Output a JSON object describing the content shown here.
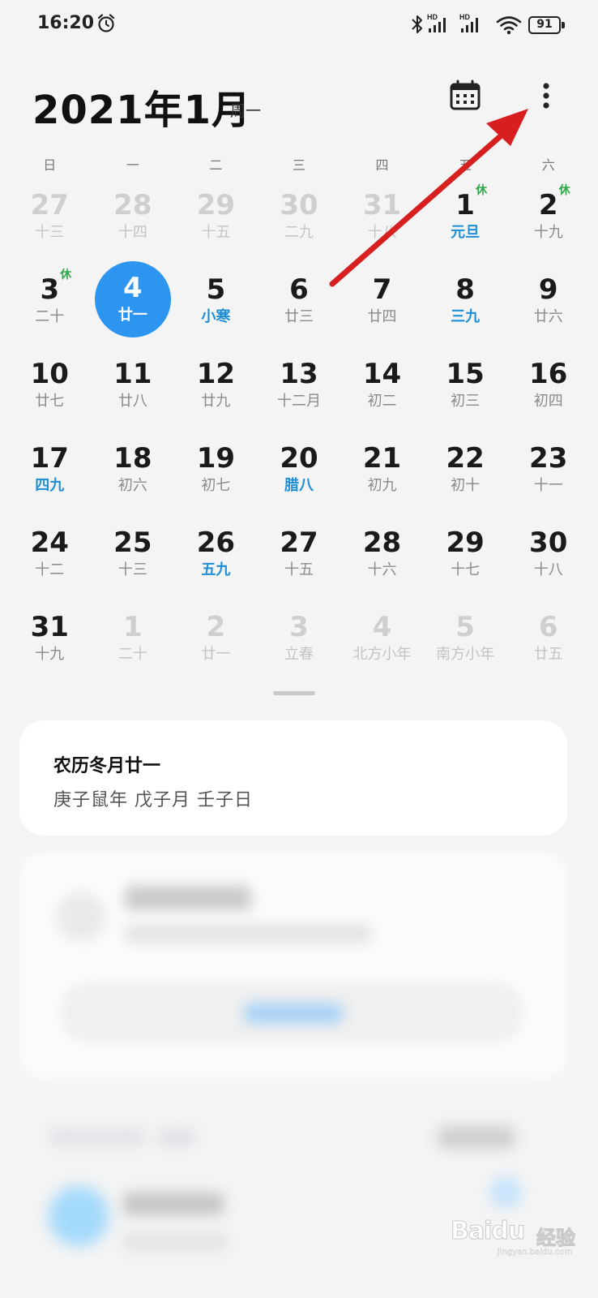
{
  "status_bar": {
    "time": "16:20",
    "battery": "91",
    "signal_labels": [
      "HD",
      "HD"
    ],
    "icons": [
      "alarm-icon",
      "bluetooth-icon",
      "signal-icon",
      "signal-icon",
      "wifi-icon",
      "battery-icon"
    ]
  },
  "header": {
    "title": "2021年1月",
    "weekday": "周一",
    "calendar_icon": "calendar-grid-icon",
    "more_icon": "more-vertical-icon"
  },
  "weekdays": [
    "日",
    "一",
    "二",
    "三",
    "四",
    "五",
    "六"
  ],
  "days": [
    {
      "n": "27",
      "l": "十三",
      "other": true
    },
    {
      "n": "28",
      "l": "十四",
      "other": true
    },
    {
      "n": "29",
      "l": "十五",
      "other": true
    },
    {
      "n": "30",
      "l": "二九",
      "other": true
    },
    {
      "n": "31",
      "l": "十八",
      "other": true
    },
    {
      "n": "1",
      "l": "元旦",
      "fest": true,
      "rest": "休"
    },
    {
      "n": "2",
      "l": "十九",
      "rest": "休"
    },
    {
      "n": "3",
      "l": "二十",
      "rest": "休"
    },
    {
      "n": "4",
      "l": "廿一",
      "selected": true
    },
    {
      "n": "5",
      "l": "小寒",
      "fest": true
    },
    {
      "n": "6",
      "l": "廿三"
    },
    {
      "n": "7",
      "l": "廿四"
    },
    {
      "n": "8",
      "l": "三九",
      "fest": true
    },
    {
      "n": "9",
      "l": "廿六"
    },
    {
      "n": "10",
      "l": "廿七"
    },
    {
      "n": "11",
      "l": "廿八"
    },
    {
      "n": "12",
      "l": "廿九"
    },
    {
      "n": "13",
      "l": "十二月"
    },
    {
      "n": "14",
      "l": "初二"
    },
    {
      "n": "15",
      "l": "初三"
    },
    {
      "n": "16",
      "l": "初四"
    },
    {
      "n": "17",
      "l": "四九",
      "fest": true
    },
    {
      "n": "18",
      "l": "初六"
    },
    {
      "n": "19",
      "l": "初七"
    },
    {
      "n": "20",
      "l": "腊八",
      "fest": true
    },
    {
      "n": "21",
      "l": "初九"
    },
    {
      "n": "22",
      "l": "初十"
    },
    {
      "n": "23",
      "l": "十一"
    },
    {
      "n": "24",
      "l": "十二"
    },
    {
      "n": "25",
      "l": "十三"
    },
    {
      "n": "26",
      "l": "五九",
      "fest": true
    },
    {
      "n": "27",
      "l": "十五"
    },
    {
      "n": "28",
      "l": "十六"
    },
    {
      "n": "29",
      "l": "十七"
    },
    {
      "n": "30",
      "l": "十八"
    },
    {
      "n": "31",
      "l": "十九"
    },
    {
      "n": "1",
      "l": "二十",
      "other": true
    },
    {
      "n": "2",
      "l": "廿一",
      "other": true
    },
    {
      "n": "3",
      "l": "立春",
      "other": true
    },
    {
      "n": "4",
      "l": "北方小年",
      "other": true
    },
    {
      "n": "5",
      "l": "南方小年",
      "other": true
    },
    {
      "n": "6",
      "l": "廿五",
      "other": true
    }
  ],
  "lunar_card": {
    "title": "农历冬月廿一",
    "detail": "庚子鼠年 戊子月 壬子日"
  },
  "colors": {
    "accent": "#2b95f0",
    "festival": "#1e8fd6",
    "rest": "#2fa74a",
    "annotation_arrow": "#e02020"
  },
  "watermark": {
    "brand": "Baidu",
    "cn": "经验",
    "sub": "jingyan.baidu.com"
  }
}
